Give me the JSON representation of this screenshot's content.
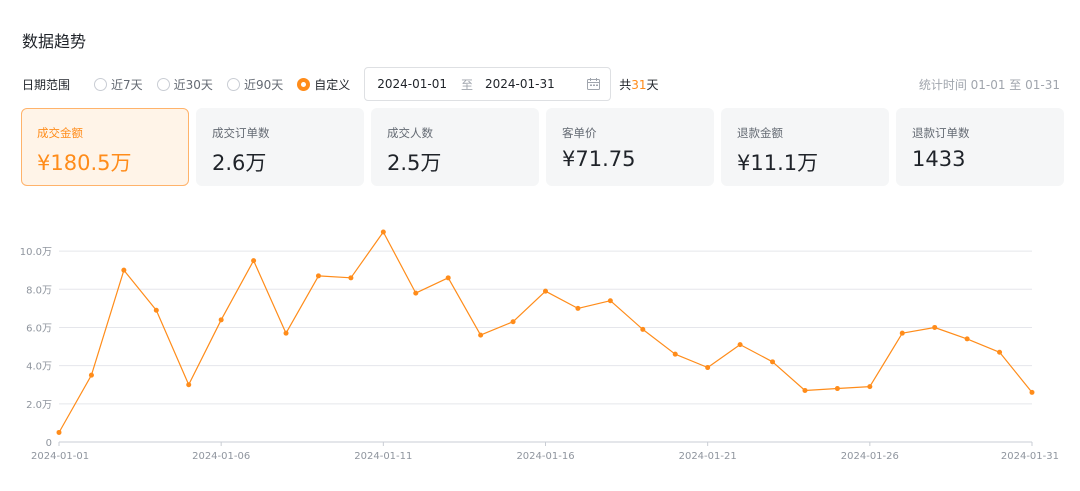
{
  "title": "数据趋势",
  "filter": {
    "label": "日期范围",
    "options": [
      "近7天",
      "近30天",
      "近90天",
      "自定义"
    ],
    "selected_index": 3,
    "start_date": "2024-01-01",
    "separator": "至",
    "end_date": "2024-01-31",
    "total_prefix": "共",
    "total_days": "31",
    "total_suffix": "天",
    "stat_time": "统计时间 01-01 至 01-31"
  },
  "cards": [
    {
      "label": "成交金额",
      "value": "¥180.5万",
      "active": true
    },
    {
      "label": "成交订单数",
      "value": "2.6万",
      "active": false
    },
    {
      "label": "成交人数",
      "value": "2.5万",
      "active": false
    },
    {
      "label": "客单价",
      "value": "¥71.75",
      "active": false
    },
    {
      "label": "退款金额",
      "value": "¥11.1万",
      "active": false
    },
    {
      "label": "退款订单数",
      "value": "1433",
      "active": false
    }
  ],
  "colors": {
    "accent": "#ff8c1a",
    "accent_light": "#fff4e8",
    "grid": "#e5e6eb",
    "axis_text": "#8f959e"
  },
  "chart_data": {
    "type": "line",
    "x": [
      "2024-01-01",
      "2024-01-02",
      "2024-01-03",
      "2024-01-04",
      "2024-01-05",
      "2024-01-06",
      "2024-01-07",
      "2024-01-08",
      "2024-01-09",
      "2024-01-10",
      "2024-01-11",
      "2024-01-12",
      "2024-01-13",
      "2024-01-14",
      "2024-01-15",
      "2024-01-16",
      "2024-01-17",
      "2024-01-18",
      "2024-01-19",
      "2024-01-20",
      "2024-01-21",
      "2024-01-22",
      "2024-01-23",
      "2024-01-24",
      "2024-01-25",
      "2024-01-26",
      "2024-01-27",
      "2024-01-28",
      "2024-01-29",
      "2024-01-30",
      "2024-01-31"
    ],
    "series": [
      {
        "values": [
          0.5,
          3.5,
          9.0,
          6.9,
          3.0,
          6.4,
          9.5,
          5.7,
          8.7,
          8.6,
          11.0,
          7.8,
          8.6,
          5.6,
          6.3,
          7.9,
          7.0,
          7.4,
          5.9,
          4.6,
          3.9,
          5.1,
          4.2,
          2.7,
          2.8,
          2.9,
          5.7,
          6.0,
          5.4,
          4.7,
          2.6
        ]
      }
    ],
    "x_tick_labels": [
      "2024-01-01",
      "2024-01-06",
      "2024-01-11",
      "2024-01-16",
      "2024-01-21",
      "2024-01-26",
      "2024-01-31"
    ],
    "y_tick_labels": [
      "0",
      "2.0万",
      "4.0万",
      "6.0万",
      "8.0万",
      "10.0万"
    ],
    "y_ticks": [
      0,
      2,
      4,
      6,
      8,
      10
    ],
    "ylim": [
      0,
      11
    ],
    "y_unit": "万",
    "grid": true,
    "xlabel": "",
    "ylabel": ""
  }
}
